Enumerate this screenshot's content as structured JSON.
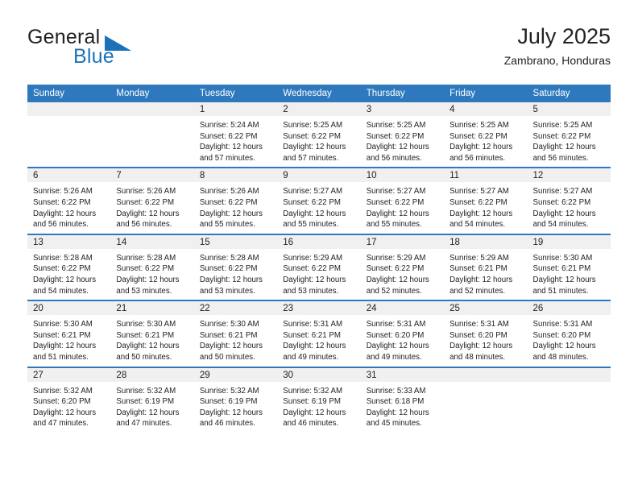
{
  "brand": {
    "name_top": "General",
    "name_bottom": "Blue",
    "accent_color": "#1b72b8"
  },
  "header": {
    "title": "July 2025",
    "subtitle": "Zambrano, Honduras"
  },
  "theme": {
    "header_bg": "#2e79bd",
    "header_text": "#ffffff",
    "daynum_band_bg": "#f0f0f0",
    "row_divider": "#2e79bd",
    "body_text": "#222222"
  },
  "calendar": {
    "weekday_headers": [
      "Sunday",
      "Monday",
      "Tuesday",
      "Wednesday",
      "Thursday",
      "Friday",
      "Saturday"
    ],
    "labels": {
      "sunrise": "Sunrise:",
      "sunset": "Sunset:",
      "daylight": "Daylight:"
    },
    "weeks": [
      [
        {
          "day": "",
          "empty": true,
          "line1": "",
          "line2": "",
          "line3": "",
          "line4": ""
        },
        {
          "day": "",
          "empty": true,
          "line1": "",
          "line2": "",
          "line3": "",
          "line4": ""
        },
        {
          "day": "1",
          "line1": "Sunrise: 5:24 AM",
          "line2": "Sunset: 6:22 PM",
          "line3": "Daylight: 12 hours",
          "line4": "and 57 minutes."
        },
        {
          "day": "2",
          "line1": "Sunrise: 5:25 AM",
          "line2": "Sunset: 6:22 PM",
          "line3": "Daylight: 12 hours",
          "line4": "and 57 minutes."
        },
        {
          "day": "3",
          "line1": "Sunrise: 5:25 AM",
          "line2": "Sunset: 6:22 PM",
          "line3": "Daylight: 12 hours",
          "line4": "and 56 minutes."
        },
        {
          "day": "4",
          "line1": "Sunrise: 5:25 AM",
          "line2": "Sunset: 6:22 PM",
          "line3": "Daylight: 12 hours",
          "line4": "and 56 minutes."
        },
        {
          "day": "5",
          "line1": "Sunrise: 5:25 AM",
          "line2": "Sunset: 6:22 PM",
          "line3": "Daylight: 12 hours",
          "line4": "and 56 minutes."
        }
      ],
      [
        {
          "day": "6",
          "line1": "Sunrise: 5:26 AM",
          "line2": "Sunset: 6:22 PM",
          "line3": "Daylight: 12 hours",
          "line4": "and 56 minutes."
        },
        {
          "day": "7",
          "line1": "Sunrise: 5:26 AM",
          "line2": "Sunset: 6:22 PM",
          "line3": "Daylight: 12 hours",
          "line4": "and 56 minutes."
        },
        {
          "day": "8",
          "line1": "Sunrise: 5:26 AM",
          "line2": "Sunset: 6:22 PM",
          "line3": "Daylight: 12 hours",
          "line4": "and 55 minutes."
        },
        {
          "day": "9",
          "line1": "Sunrise: 5:27 AM",
          "line2": "Sunset: 6:22 PM",
          "line3": "Daylight: 12 hours",
          "line4": "and 55 minutes."
        },
        {
          "day": "10",
          "line1": "Sunrise: 5:27 AM",
          "line2": "Sunset: 6:22 PM",
          "line3": "Daylight: 12 hours",
          "line4": "and 55 minutes."
        },
        {
          "day": "11",
          "line1": "Sunrise: 5:27 AM",
          "line2": "Sunset: 6:22 PM",
          "line3": "Daylight: 12 hours",
          "line4": "and 54 minutes."
        },
        {
          "day": "12",
          "line1": "Sunrise: 5:27 AM",
          "line2": "Sunset: 6:22 PM",
          "line3": "Daylight: 12 hours",
          "line4": "and 54 minutes."
        }
      ],
      [
        {
          "day": "13",
          "line1": "Sunrise: 5:28 AM",
          "line2": "Sunset: 6:22 PM",
          "line3": "Daylight: 12 hours",
          "line4": "and 54 minutes."
        },
        {
          "day": "14",
          "line1": "Sunrise: 5:28 AM",
          "line2": "Sunset: 6:22 PM",
          "line3": "Daylight: 12 hours",
          "line4": "and 53 minutes."
        },
        {
          "day": "15",
          "line1": "Sunrise: 5:28 AM",
          "line2": "Sunset: 6:22 PM",
          "line3": "Daylight: 12 hours",
          "line4": "and 53 minutes."
        },
        {
          "day": "16",
          "line1": "Sunrise: 5:29 AM",
          "line2": "Sunset: 6:22 PM",
          "line3": "Daylight: 12 hours",
          "line4": "and 53 minutes."
        },
        {
          "day": "17",
          "line1": "Sunrise: 5:29 AM",
          "line2": "Sunset: 6:22 PM",
          "line3": "Daylight: 12 hours",
          "line4": "and 52 minutes."
        },
        {
          "day": "18",
          "line1": "Sunrise: 5:29 AM",
          "line2": "Sunset: 6:21 PM",
          "line3": "Daylight: 12 hours",
          "line4": "and 52 minutes."
        },
        {
          "day": "19",
          "line1": "Sunrise: 5:30 AM",
          "line2": "Sunset: 6:21 PM",
          "line3": "Daylight: 12 hours",
          "line4": "and 51 minutes."
        }
      ],
      [
        {
          "day": "20",
          "line1": "Sunrise: 5:30 AM",
          "line2": "Sunset: 6:21 PM",
          "line3": "Daylight: 12 hours",
          "line4": "and 51 minutes."
        },
        {
          "day": "21",
          "line1": "Sunrise: 5:30 AM",
          "line2": "Sunset: 6:21 PM",
          "line3": "Daylight: 12 hours",
          "line4": "and 50 minutes."
        },
        {
          "day": "22",
          "line1": "Sunrise: 5:30 AM",
          "line2": "Sunset: 6:21 PM",
          "line3": "Daylight: 12 hours",
          "line4": "and 50 minutes."
        },
        {
          "day": "23",
          "line1": "Sunrise: 5:31 AM",
          "line2": "Sunset: 6:21 PM",
          "line3": "Daylight: 12 hours",
          "line4": "and 49 minutes."
        },
        {
          "day": "24",
          "line1": "Sunrise: 5:31 AM",
          "line2": "Sunset: 6:20 PM",
          "line3": "Daylight: 12 hours",
          "line4": "and 49 minutes."
        },
        {
          "day": "25",
          "line1": "Sunrise: 5:31 AM",
          "line2": "Sunset: 6:20 PM",
          "line3": "Daylight: 12 hours",
          "line4": "and 48 minutes."
        },
        {
          "day": "26",
          "line1": "Sunrise: 5:31 AM",
          "line2": "Sunset: 6:20 PM",
          "line3": "Daylight: 12 hours",
          "line4": "and 48 minutes."
        }
      ],
      [
        {
          "day": "27",
          "line1": "Sunrise: 5:32 AM",
          "line2": "Sunset: 6:20 PM",
          "line3": "Daylight: 12 hours",
          "line4": "and 47 minutes."
        },
        {
          "day": "28",
          "line1": "Sunrise: 5:32 AM",
          "line2": "Sunset: 6:19 PM",
          "line3": "Daylight: 12 hours",
          "line4": "and 47 minutes."
        },
        {
          "day": "29",
          "line1": "Sunrise: 5:32 AM",
          "line2": "Sunset: 6:19 PM",
          "line3": "Daylight: 12 hours",
          "line4": "and 46 minutes."
        },
        {
          "day": "30",
          "line1": "Sunrise: 5:32 AM",
          "line2": "Sunset: 6:19 PM",
          "line3": "Daylight: 12 hours",
          "line4": "and 46 minutes."
        },
        {
          "day": "31",
          "line1": "Sunrise: 5:33 AM",
          "line2": "Sunset: 6:18 PM",
          "line3": "Daylight: 12 hours",
          "line4": "and 45 minutes."
        },
        {
          "day": "",
          "empty": true,
          "line1": "",
          "line2": "",
          "line3": "",
          "line4": ""
        },
        {
          "day": "",
          "empty": true,
          "line1": "",
          "line2": "",
          "line3": "",
          "line4": ""
        }
      ]
    ]
  }
}
